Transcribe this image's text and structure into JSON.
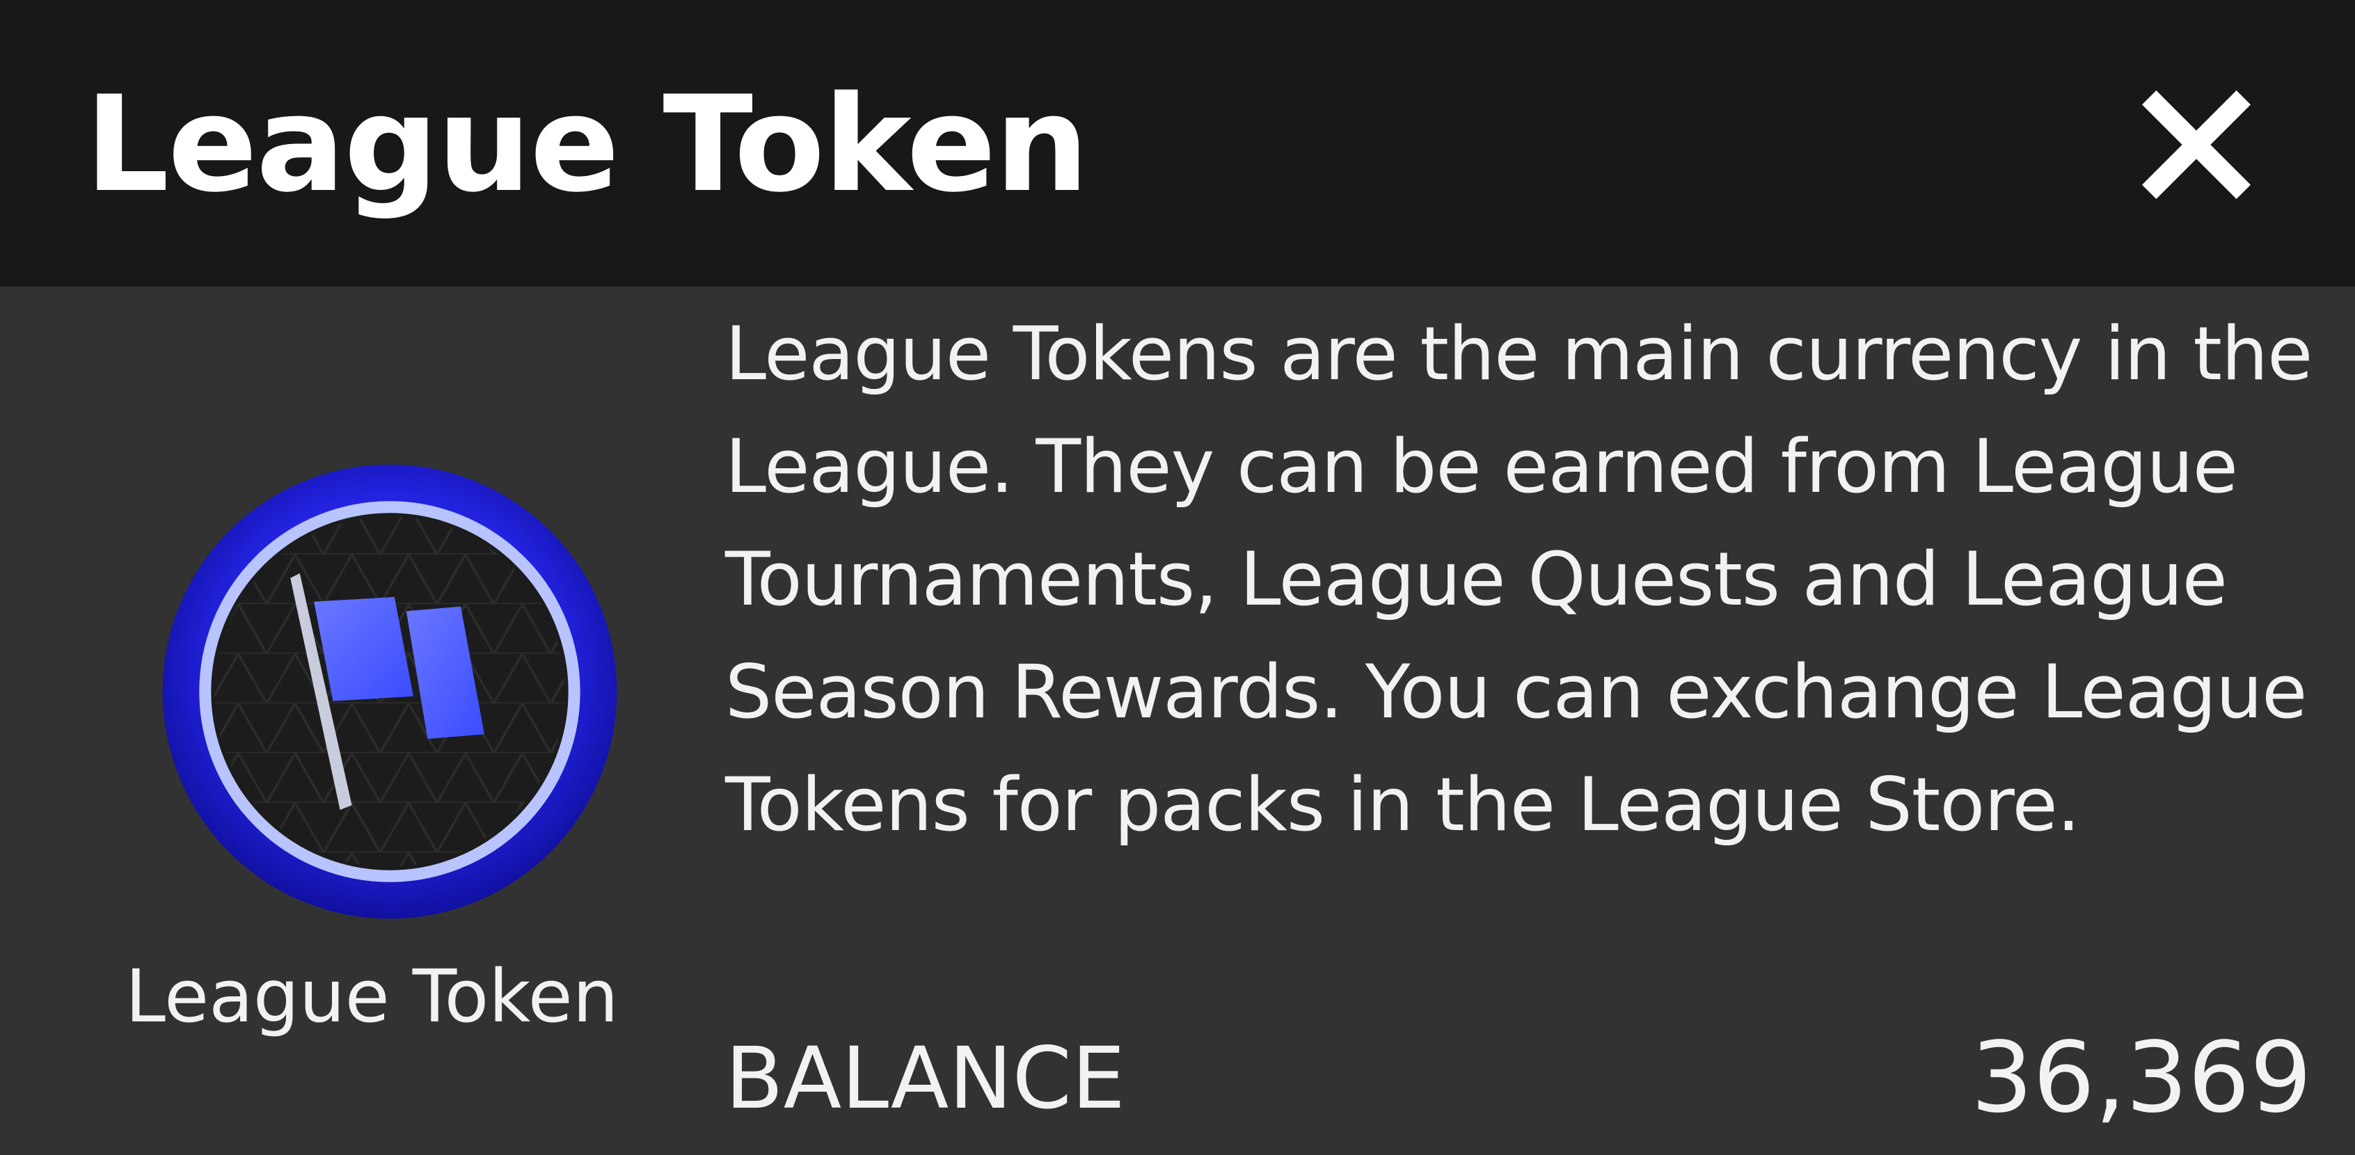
{
  "dialog": {
    "title": "League Token",
    "close_icon": "close-icon"
  },
  "token": {
    "icon": "league-token-flag-icon",
    "label": "League Token",
    "accent_color": "#2b2be8"
  },
  "description": "League Tokens are the main currency in the League. They can be earned from League Tournaments, League Quests and League Season Rewards. You can exchange League Tokens for packs in the League Store.",
  "balance": {
    "label": "BALANCE",
    "value": "36,369"
  }
}
